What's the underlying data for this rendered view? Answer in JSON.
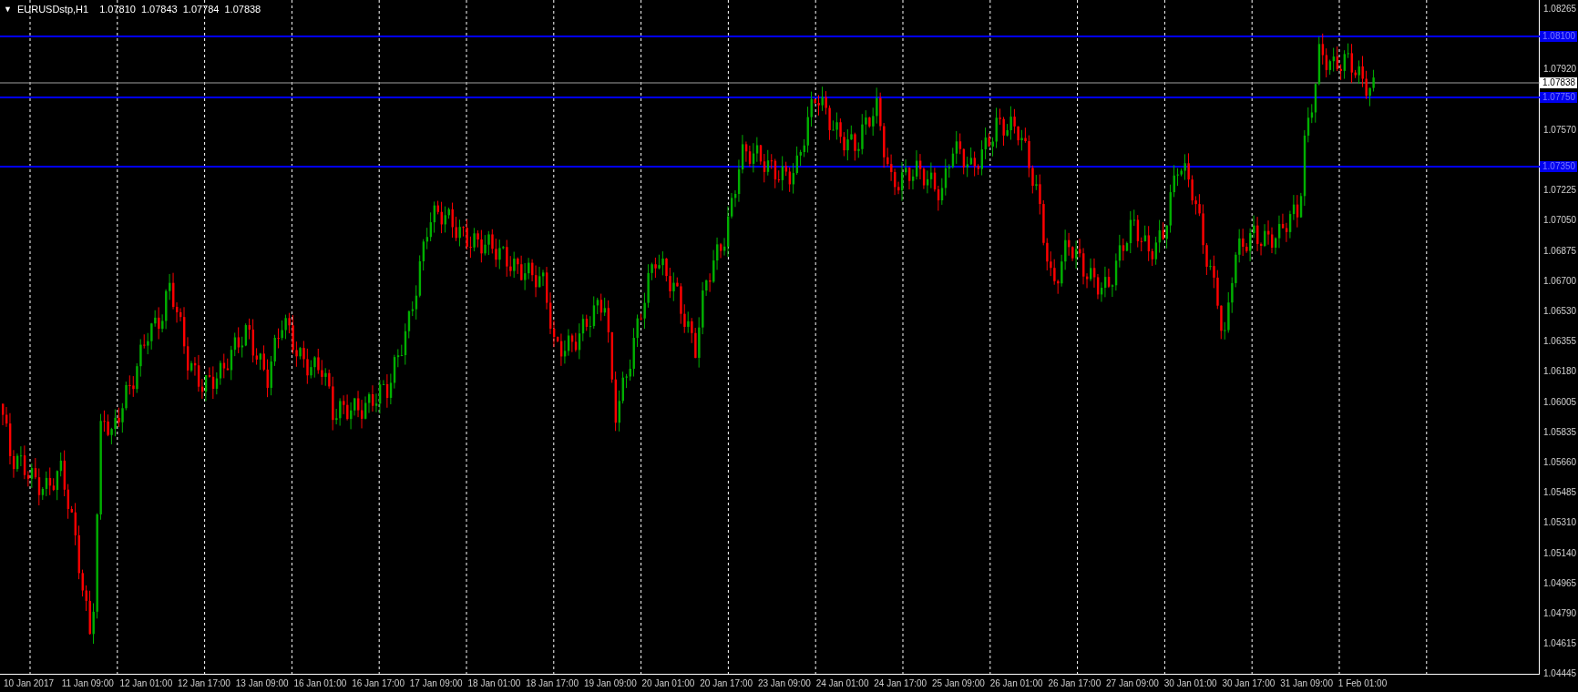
{
  "header": {
    "menu_glyph": "▼",
    "symbol": "EURUSDstp,H1",
    "values": [
      "1.07810",
      "1.07843",
      "1.07784",
      "1.07838"
    ]
  },
  "levels": [
    {
      "label": "1.08100"
    },
    {
      "label": "1.07750"
    },
    {
      "label": "1.07350"
    }
  ],
  "current_price": {
    "label": "1.07838"
  },
  "price_axis": {
    "ticks": [
      "1.08265",
      "1.07920",
      "1.07570",
      "1.07225",
      "1.07050",
      "1.06875",
      "1.06700",
      "1.06530",
      "1.06355",
      "1.06180",
      "1.06005",
      "1.05835",
      "1.05660",
      "1.05485",
      "1.05310",
      "1.05140",
      "1.04965",
      "1.04790",
      "1.04615",
      "1.04445"
    ]
  },
  "time_axis": {
    "labels": [
      "10 Jan 2017",
      "11 Jan 09:00",
      "12 Jan 01:00",
      "12 Jan 17:00",
      "13 Jan 09:00",
      "16 Jan 01:00",
      "16 Jan 17:00",
      "17 Jan 09:00",
      "18 Jan 01:00",
      "18 Jan 17:00",
      "19 Jan 09:00",
      "20 Jan 01:00",
      "20 Jan 17:00",
      "23 Jan 09:00",
      "24 Jan 01:00",
      "24 Jan 17:00",
      "25 Jan 09:00",
      "26 Jan 01:00",
      "26 Jan 17:00",
      "27 Jan 09:00",
      "30 Jan 01:00",
      "30 Jan 17:00",
      "31 Jan 09:00",
      "1 Feb 01:00"
    ]
  }
}
